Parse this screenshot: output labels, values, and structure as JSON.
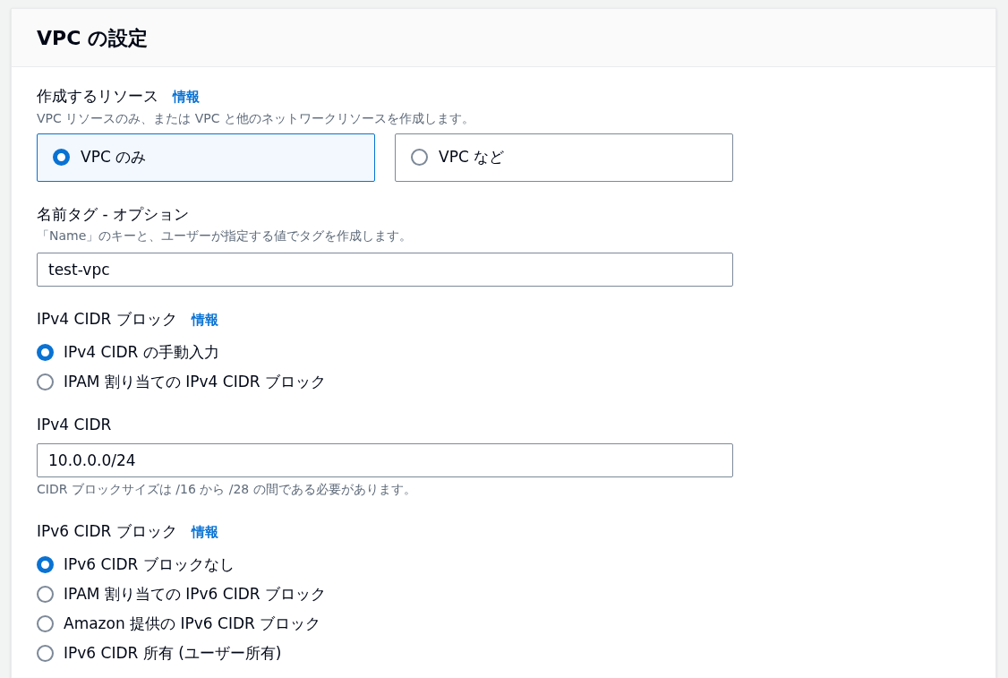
{
  "panel": {
    "title": "VPC の設定"
  },
  "fields": [
    {
      "kind": "tiles",
      "label": "作成するリソース",
      "info": "情報",
      "description": "VPC リソースのみ、または VPC と他のネットワークリソースを作成します。",
      "options": [
        {
          "label": "VPC のみ",
          "selected": true
        },
        {
          "label": "VPC など",
          "selected": false
        }
      ]
    },
    {
      "kind": "text",
      "label": "名前タグ - オプション",
      "description": "「Name」のキーと、ユーザーが指定する値でタグを作成します。",
      "value": "test-vpc"
    },
    {
      "kind": "radios",
      "label": "IPv4 CIDR ブロック",
      "info": "情報",
      "options": [
        {
          "label": "IPv4 CIDR の手動入力",
          "selected": true
        },
        {
          "label": "IPAM 割り当ての IPv4 CIDR ブロック",
          "selected": false
        }
      ]
    },
    {
      "kind": "text",
      "label": "IPv4 CIDR",
      "value": "10.0.0.0/24",
      "hint": "CIDR ブロックサイズは /16 から /28 の間である必要があります。"
    },
    {
      "kind": "radios",
      "label": "IPv6 CIDR ブロック",
      "info": "情報",
      "options": [
        {
          "label": "IPv6 CIDR ブロックなし",
          "selected": true
        },
        {
          "label": "IPAM 割り当ての IPv6 CIDR ブロック",
          "selected": false
        },
        {
          "label": "Amazon 提供の IPv6 CIDR ブロック",
          "selected": false
        },
        {
          "label": "IPv6 CIDR 所有 (ユーザー所有)",
          "selected": false
        }
      ]
    }
  ]
}
